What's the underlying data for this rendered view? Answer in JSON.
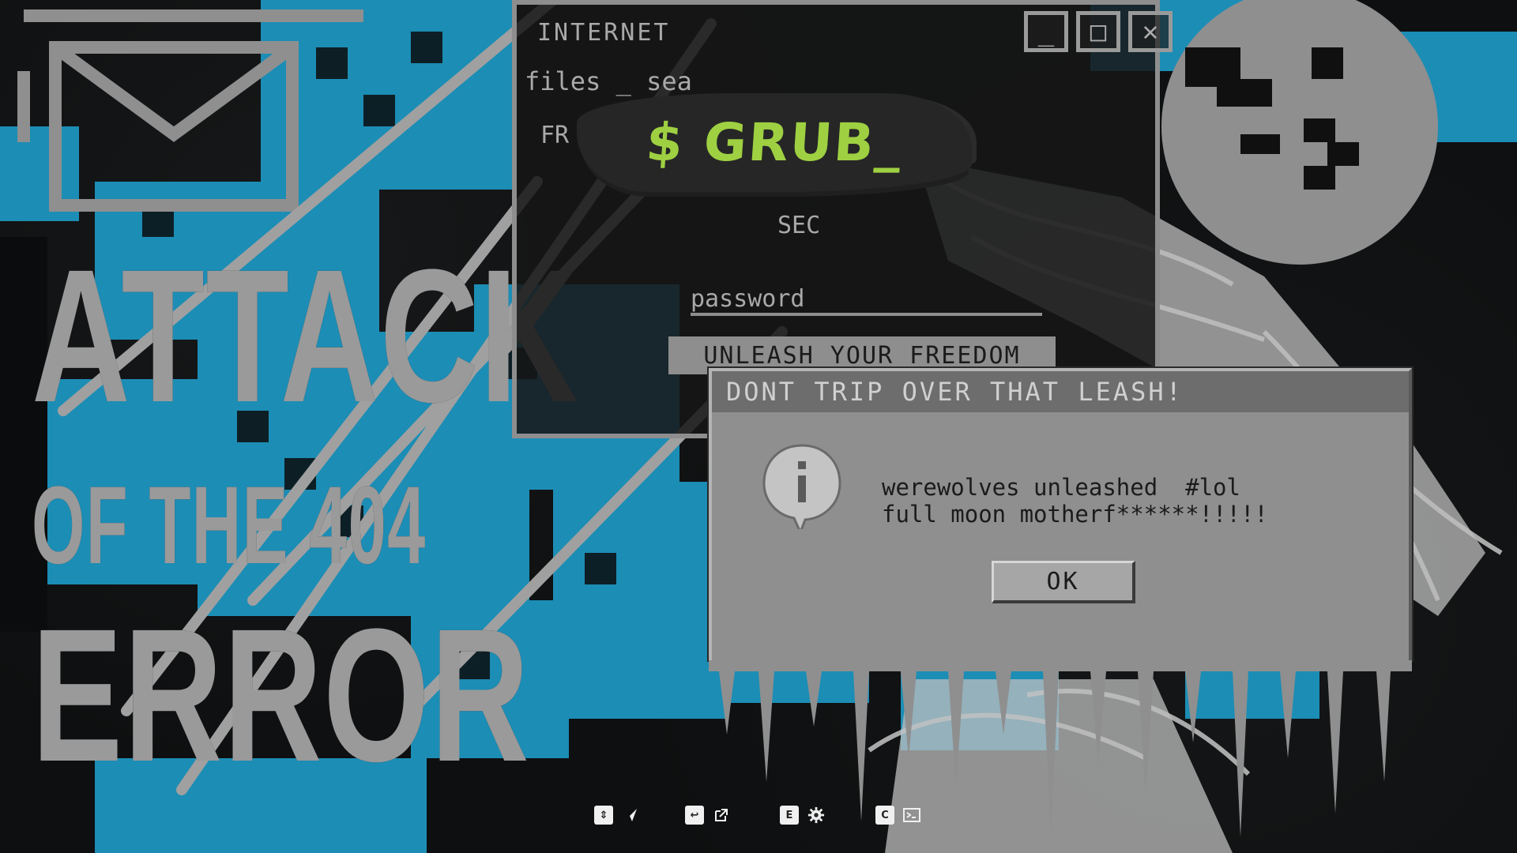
{
  "background": {
    "poster_line_1": "ATTACK",
    "poster_line_2": "OF THE 404",
    "poster_line_3": "ERROR",
    "colors": {
      "blue": "#1a8fb8",
      "gray": "#8f8f8f",
      "dark": "#111111"
    }
  },
  "back_window": {
    "title": "INTERNET",
    "subtitle": "files _ sea",
    "field_label": "FR",
    "search_label": "SEC",
    "password_label": "password",
    "unleash_button": "UNLEASH YOUR FREEDOM",
    "window_buttons": {
      "minimize_icon": "minimize-icon",
      "maximize_icon": "maximize-icon",
      "close_icon": "close-icon"
    }
  },
  "banner": {
    "text": "$ GRUB_",
    "color": "#9ed042"
  },
  "dialog": {
    "title": "DONT TRIP OVER THAT LEASH!",
    "icon": "info-icon",
    "message_line_1": "werewolves unleashed  #lol",
    "message_line_2": "full moon motherf******!!!!!",
    "ok_label": "OK"
  },
  "hint_bar": {
    "items": [
      {
        "badge": "⇕",
        "icon": "send-icon"
      },
      {
        "badge": "↩",
        "icon": "open-external-icon"
      },
      {
        "badge": "E",
        "icon": "gear-icon"
      },
      {
        "badge": "C",
        "icon": "terminal-icon"
      }
    ]
  }
}
